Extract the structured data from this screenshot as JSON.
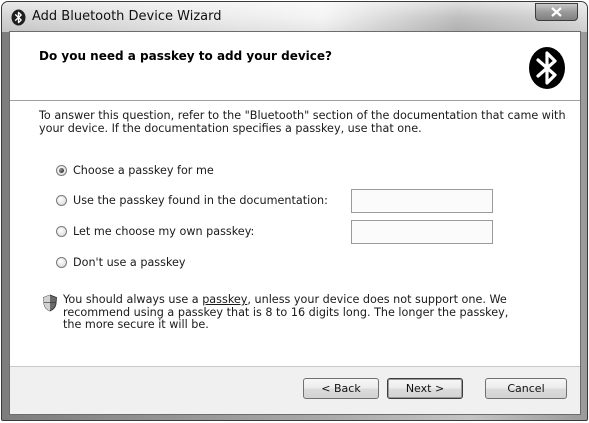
{
  "window": {
    "title": "Add Bluetooth Device Wizard"
  },
  "header": {
    "title": "Do you need a passkey to add your device?"
  },
  "description": "To answer this question, refer to the \"Bluetooth\" section of the documentation that came with your device. If the documentation specifies a passkey, use that one.",
  "options": [
    {
      "label": "Choose a passkey for me",
      "checked": true
    },
    {
      "label": "Use the passkey found in the documentation:",
      "checked": false
    },
    {
      "label": "Let me choose my own passkey:",
      "checked": false
    },
    {
      "label": "Don't use a passkey",
      "checked": false
    }
  ],
  "inputs": {
    "documentation_passkey": {
      "value": ""
    },
    "own_passkey": {
      "value": ""
    }
  },
  "note": {
    "prefix": "You should always use a ",
    "link": "passkey",
    "suffix": ", unless your device does not support one. We recommend using a passkey that is 8 to 16 digits long. The longer the passkey, the more secure it will be."
  },
  "buttons": {
    "back": "< Back",
    "next": "Next >",
    "cancel": "Cancel"
  },
  "icons": {
    "title_icon": "bluetooth-icon",
    "header_logo": "bluetooth-logo-icon",
    "note_icon": "shield-icon",
    "close_icon": "close-icon"
  }
}
